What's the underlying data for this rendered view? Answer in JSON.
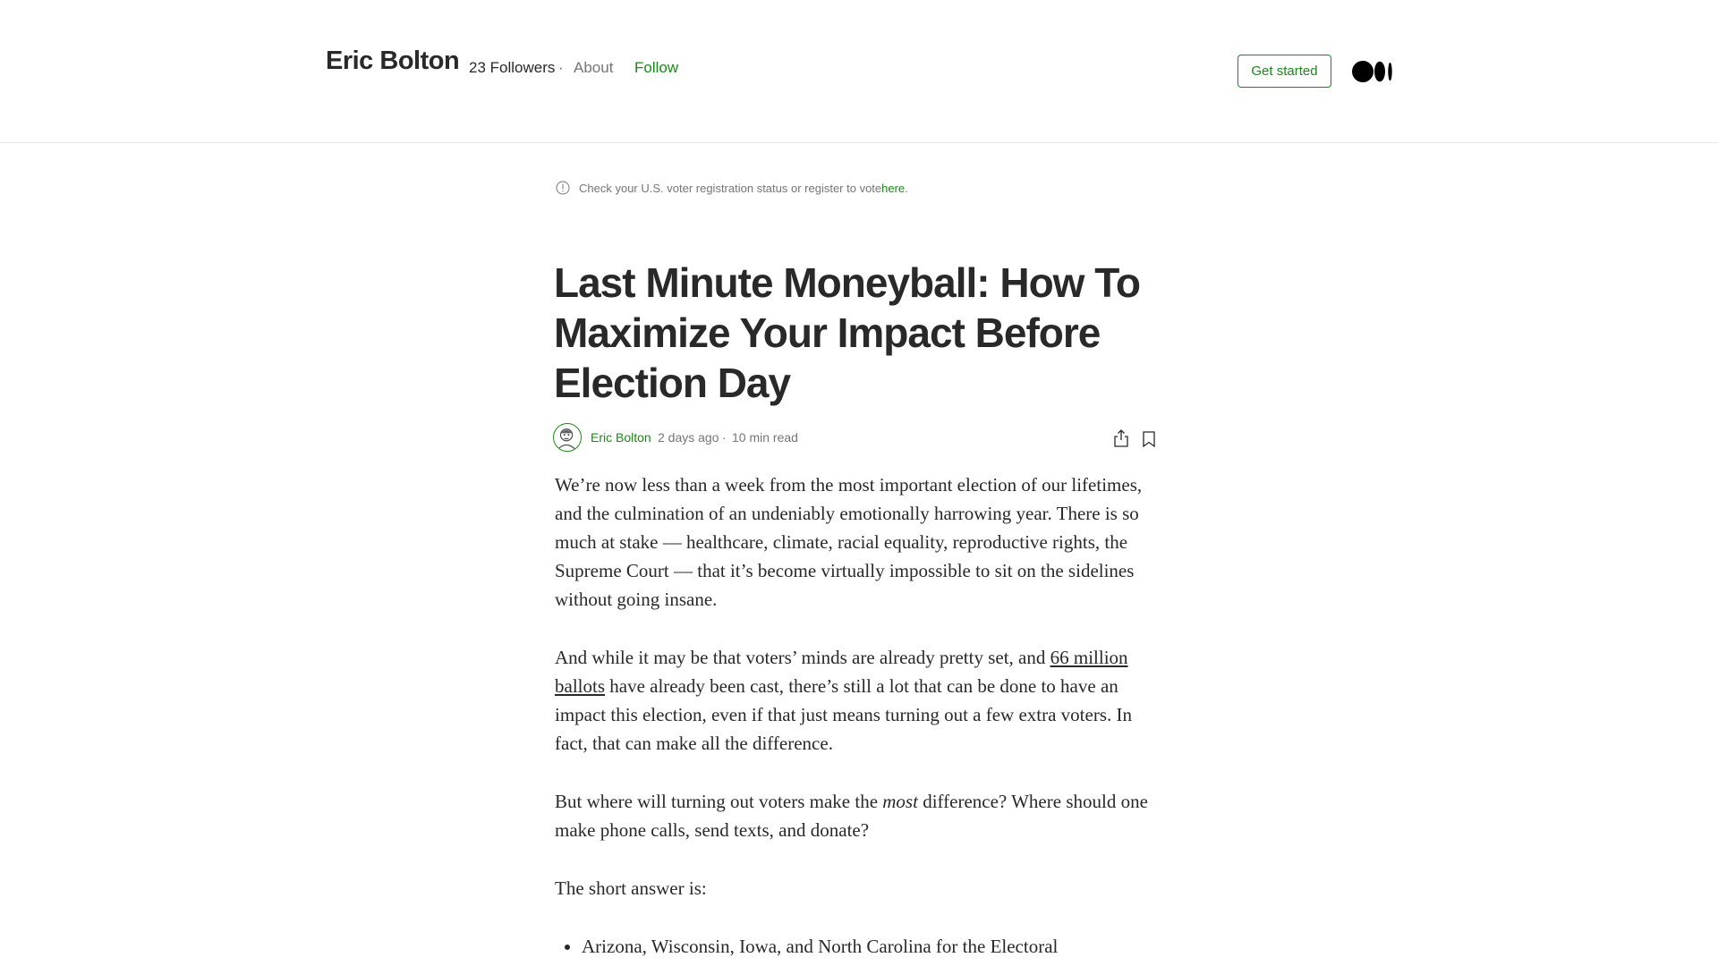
{
  "header": {
    "publication_name": "Eric Bolton",
    "followers": "23 Followers",
    "separator": "·",
    "about_label": "About",
    "follow_label": "Follow",
    "get_started_label": "Get started",
    "logo_icon": "medium-logo-icon"
  },
  "notice": {
    "icon": "info-circle-icon",
    "text": "Check your U.S. voter registration status or register to vote ",
    "link_text": "here",
    "suffix": "."
  },
  "article": {
    "title": "Last Minute Moneyball: How To Maximize Your Impact Before Election Day",
    "author": "Eric Bolton",
    "date": "2 days ago",
    "dot": "·",
    "read_time": "10 min read",
    "share_icon": "share-icon",
    "bookmark_icon": "bookmark-icon",
    "p1": "We’re now less than a week from the most important election of our lifetimes, and the culmination of an undeniably emotionally harrowing year. There is so much at stake — healthcare, climate, racial equality, reproductive rights, the Supreme Court — that it’s become virtually impossible to sit on the sidelines without going insane.",
    "p2_a": "And while it may be that voters’ minds are already pretty set, and ",
    "p2_link": "66 million ballots",
    "p2_b": " have already been cast, there’s still a lot that can be done to have an impact this election, even if that just means turning out a few extra voters. In fact, that can make all the difference.",
    "p3_a": "But where will turning out voters make the ",
    "p3_em": "most",
    "p3_b": " difference? Where should one make phone calls, send texts, and donate?",
    "p4": "The short answer is:",
    "list_item_1": "Arizona, Wisconsin, Iowa, and North Carolina for the Electoral"
  },
  "colors": {
    "accent_green": "#1a8917",
    "text_primary": "#292929",
    "text_muted": "#757575"
  }
}
